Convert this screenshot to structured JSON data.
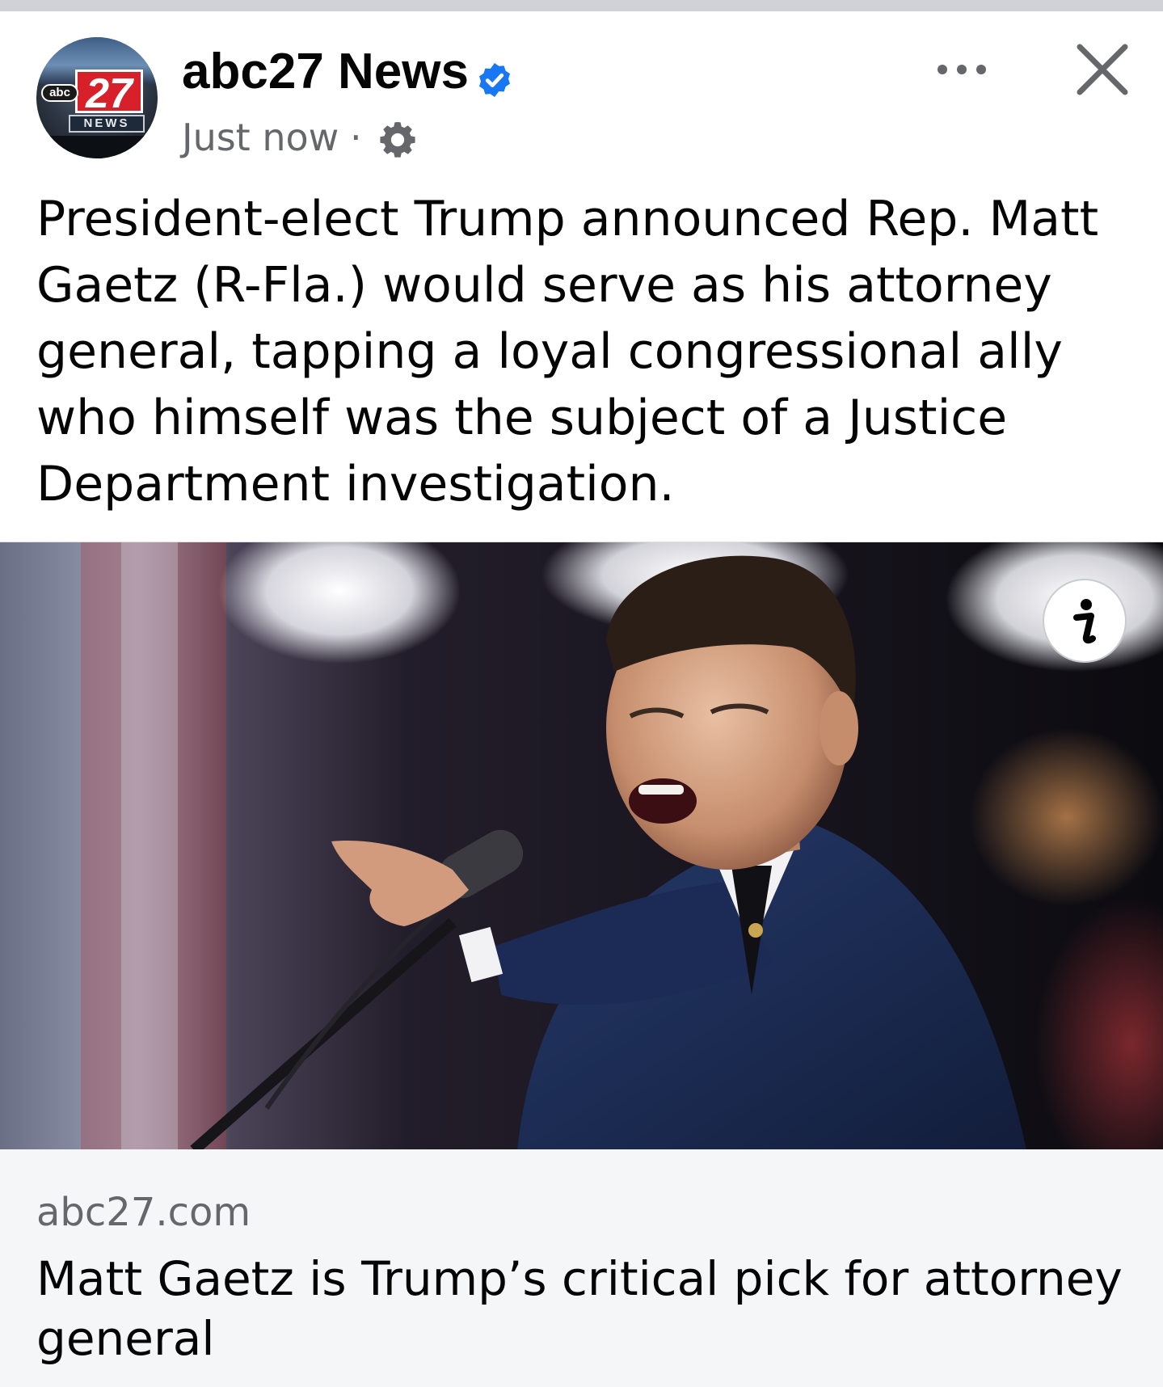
{
  "post": {
    "page_name": "abc27 News",
    "timestamp": "Just now",
    "separator": "·",
    "text": "President-elect Trump announced Rep. Matt Gaetz (R-Fla.) would serve as his attorney general, tapping a loyal congressional ally who himself was the subject of a Justice Department investigation.",
    "avatar": {
      "logo_abc": "abc",
      "logo_number": "27",
      "logo_news": "NEWS"
    }
  },
  "icons": {
    "verified": "verified-badge-icon",
    "audience": "gear-icon",
    "more": "more-options-icon",
    "close": "close-icon",
    "info": "info-icon"
  },
  "colors": {
    "verified_blue": "#1877f2",
    "muted_text": "#65676b",
    "link_card_bg": "#f5f6f8"
  },
  "link_preview": {
    "domain": "abc27.com",
    "title": "Matt Gaetz is Trump’s critical pick for attorney general"
  }
}
